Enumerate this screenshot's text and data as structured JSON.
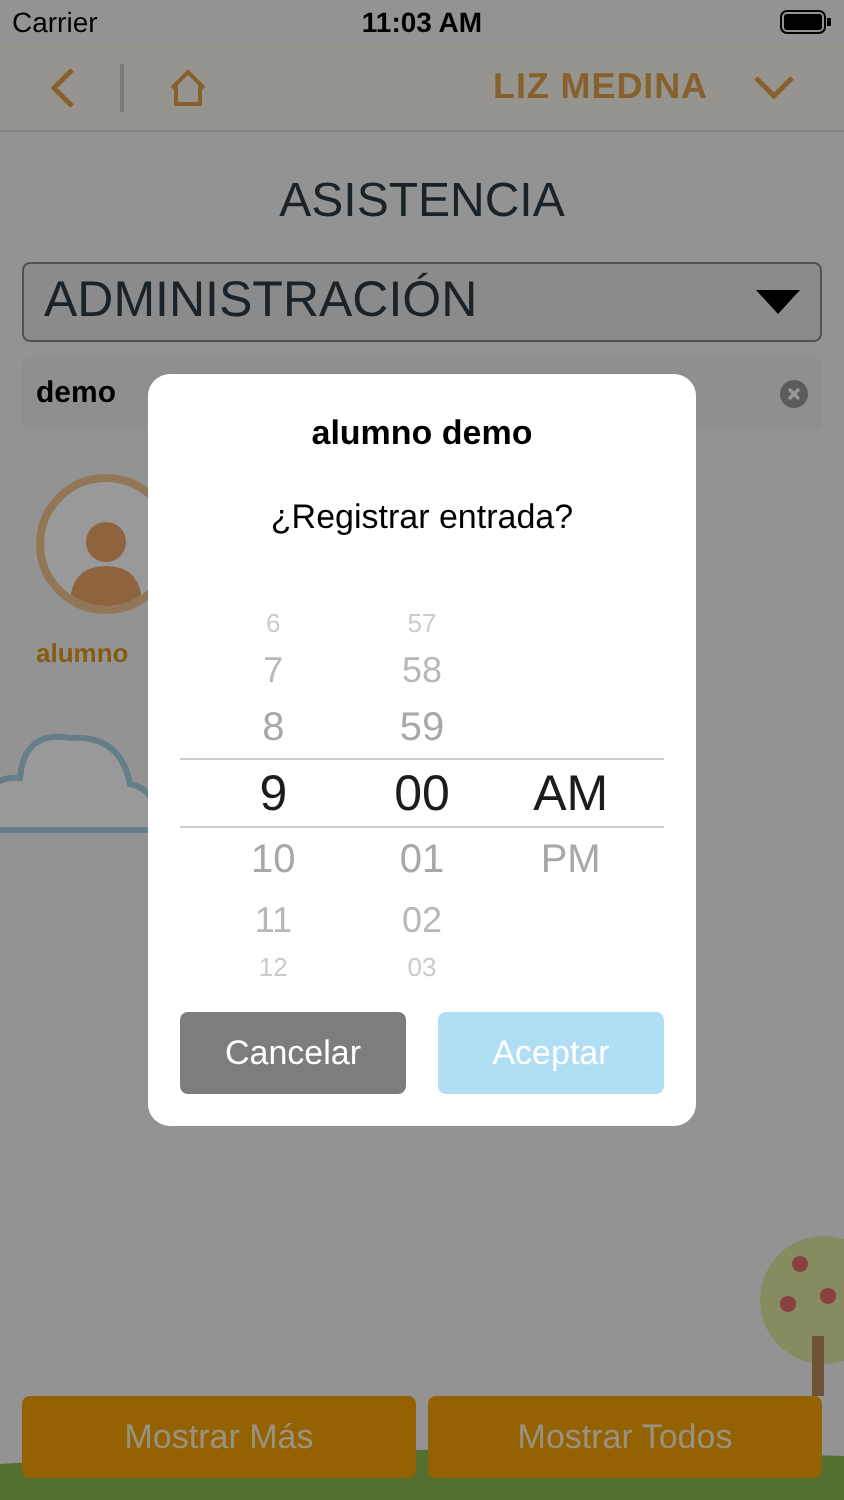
{
  "status_bar": {
    "carrier": "Carrier",
    "time": "11:03 AM"
  },
  "nav": {
    "user": "LIZ MEDINA"
  },
  "title": "ASISTENCIA",
  "dropdown": {
    "value": "ADMINISTRACIÓN"
  },
  "search": {
    "value": "demo"
  },
  "students": [
    {
      "name": "alumno"
    }
  ],
  "dialog": {
    "title": "alumno demo",
    "message": "¿Registrar entrada?",
    "picker": [
      {
        "kind": "hour",
        "items": [
          {
            "label": "6",
            "selected": false
          },
          {
            "label": "7",
            "selected": false
          },
          {
            "label": "8",
            "selected": false
          },
          {
            "label": "9",
            "selected": true
          },
          {
            "label": "10",
            "selected": false
          },
          {
            "label": "11",
            "selected": false
          },
          {
            "label": "12",
            "selected": false
          }
        ]
      },
      {
        "kind": "minute",
        "items": [
          {
            "label": "57",
            "selected": false
          },
          {
            "label": "58",
            "selected": false
          },
          {
            "label": "59",
            "selected": false
          },
          {
            "label": "00",
            "selected": true
          },
          {
            "label": "01",
            "selected": false
          },
          {
            "label": "02",
            "selected": false
          },
          {
            "label": "03",
            "selected": false
          }
        ]
      },
      {
        "kind": "period",
        "items": [
          {
            "label": "AM",
            "selected": true
          },
          {
            "label": "PM",
            "selected": false
          }
        ]
      }
    ],
    "buttons": [
      {
        "label": "Cancelar",
        "kind": "cancel"
      },
      {
        "label": "Aceptar",
        "kind": "accept"
      }
    ]
  },
  "footer_buttons": [
    "Mostrar Más",
    "Mostrar Todos"
  ]
}
